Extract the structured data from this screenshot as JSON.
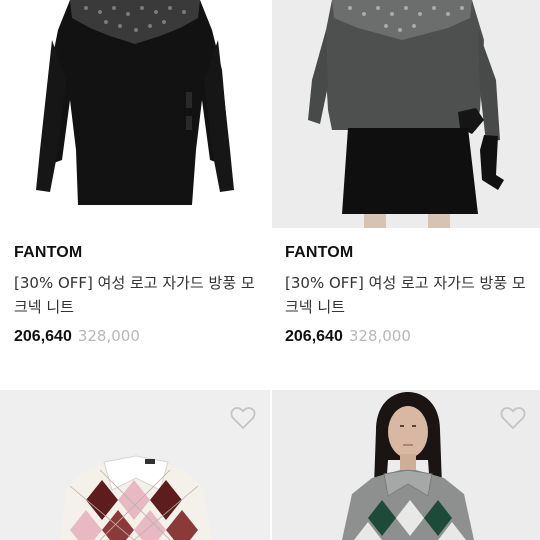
{
  "products": [
    {
      "brand": "FANTOM",
      "title": "[30% OFF] 여성 로고 자가드 방풍 모크넥 니트",
      "price": "206,640",
      "original_price": "328,000",
      "image_alt": "black sweater"
    },
    {
      "brand": "FANTOM",
      "title": "[30% OFF] 여성 로고 자가드 방풍 모크넥 니트",
      "price": "206,640",
      "original_price": "328,000",
      "image_alt": "charcoal sweater on model"
    },
    {
      "image_alt": "ivory pink argyle collar sweater",
      "icon": "heart-outline-icon"
    },
    {
      "image_alt": "grey green argyle collar sweater on model",
      "icon": "heart-outline-icon"
    }
  ],
  "colors": {
    "price": "#111111",
    "original_price": "#b8b8b8",
    "image_bg": "#ededed"
  }
}
